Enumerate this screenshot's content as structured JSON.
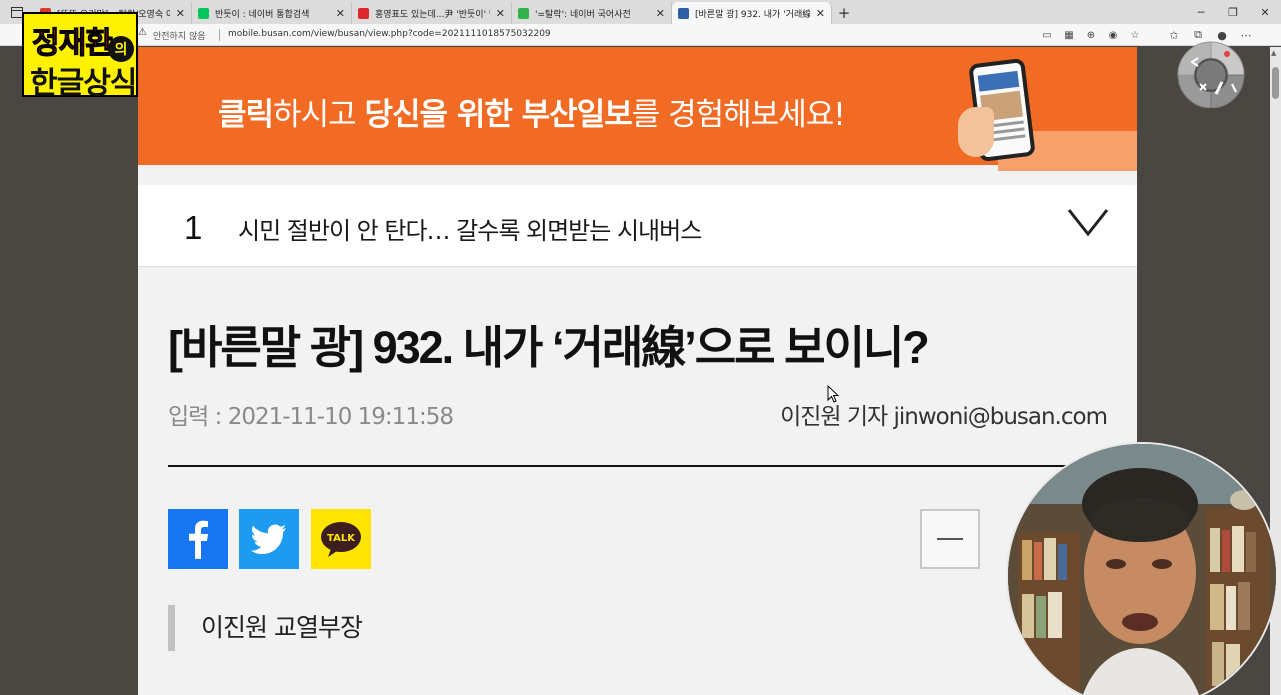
{
  "browser": {
    "tabs": [
      {
        "label": "[뚜뚜 오리맛] =탈락/오영숙 어트",
        "color": "#d93a2b",
        "active": false
      },
      {
        "label": "반듯이 : 네이버 통합검색",
        "color": "#03c75a",
        "active": false
      },
      {
        "label": "홍영표도 있는데...尹 '반듯이' 방",
        "color": "#e0262b",
        "active": false
      },
      {
        "label": "'=탈락': 네이버 국어사전",
        "color": "#2fb34a",
        "active": false
      },
      {
        "label": "[바른말 광] 932. 내가 '거래線'으로",
        "color": "#2d5fa8",
        "active": true
      }
    ],
    "new_tab_symbol": "+",
    "security_text": "안전하지 않음",
    "url": "mobile.busan.com/view/busan/view.php?code=2021111018575032209"
  },
  "logo": {
    "line1": "정재환",
    "particle": "의",
    "line2": "한글상식"
  },
  "banner": {
    "seg1_bold": "클릭",
    "seg2": "하시고 ",
    "seg3_bold": "당신을 위한 부산일보",
    "seg4": "를 경험해보세요!"
  },
  "ranking": {
    "number": "1",
    "title": "시민 절반이 안 탄다… 갈수록 외면받는 시내버스"
  },
  "article": {
    "headline": "[바른말 광] 932. 내가 ‘거래線’으로 보이니?",
    "date": "입력 : 2021-11-10 19:11:58",
    "author": "이진원 기자 jinwoni@busan.com",
    "byline": "이진원 교열부장"
  },
  "share": {
    "kakao_label": "TALK"
  },
  "colors": {
    "banner_orange": "#f26b24",
    "facebook": "#1876f2",
    "twitter": "#1d9bf0",
    "kakao": "#fee500",
    "logo_yellow": "#fff200"
  }
}
